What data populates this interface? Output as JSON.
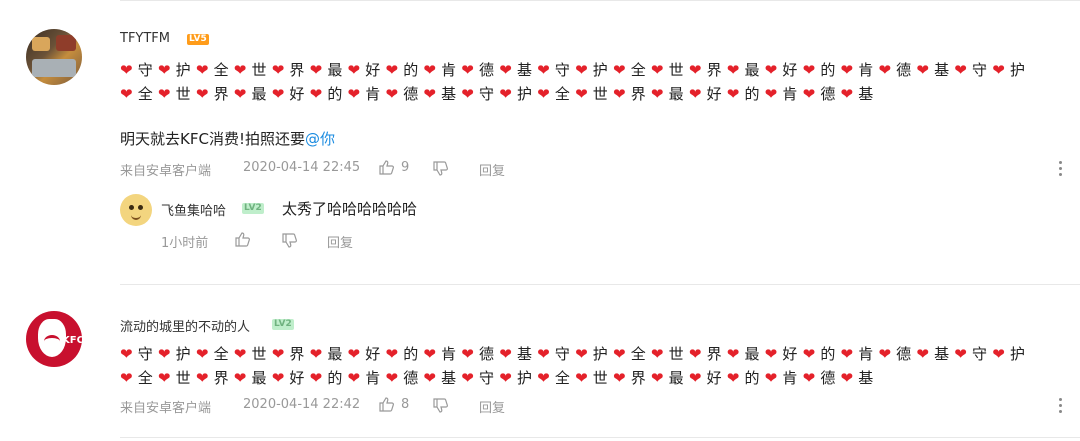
{
  "heart_glyph": "❤",
  "comments": [
    {
      "username": "TFYTFM",
      "level": "LV5",
      "heart_rows": [
        [
          "守",
          "护",
          "全",
          "世",
          "界",
          "最",
          "好",
          "的",
          "肯",
          "德",
          "基",
          "守",
          "护",
          "全",
          "世",
          "界",
          "最",
          "好",
          "的",
          "肯",
          "德",
          "基",
          "守",
          "护"
        ],
        [
          "全",
          "世",
          "界",
          "最",
          "好",
          "的",
          "肯",
          "德",
          "基",
          "守",
          "护",
          "全",
          "世",
          "界",
          "最",
          "好",
          "的",
          "肯",
          "德",
          "基"
        ]
      ],
      "text_prefix": "明天就去KFC消费!拍照还要",
      "mention": "@你",
      "source": "来自安卓客户端",
      "time": "2020-04-14 22:45",
      "likes": "9",
      "reply_label": "回复",
      "reply": {
        "username": "飞鱼集哈哈",
        "level": "LV2",
        "text": "太秀了哈哈哈哈哈哈",
        "time": "1小时前",
        "reply_label": "回复"
      }
    },
    {
      "username": "流动的城里的不动的人",
      "level": "LV2",
      "heart_rows": [
        [
          "守",
          "护",
          "全",
          "世",
          "界",
          "最",
          "好",
          "的",
          "肯",
          "德",
          "基",
          "守",
          "护",
          "全",
          "世",
          "界",
          "最",
          "好",
          "的",
          "肯",
          "德",
          "基",
          "守",
          "护"
        ],
        [
          "全",
          "世",
          "界",
          "最",
          "好",
          "的",
          "肯",
          "德",
          "基",
          "守",
          "护",
          "全",
          "世",
          "界",
          "最",
          "好",
          "的",
          "肯",
          "德",
          "基"
        ]
      ],
      "source": "来自安卓客户端",
      "time": "2020-04-14 22:42",
      "likes": "8",
      "reply_label": "回复"
    }
  ],
  "colors": {
    "heart": "#e4212a",
    "mention": "#1a8be0",
    "level5": "#ff9c1a",
    "level2": "#bfeecb"
  }
}
